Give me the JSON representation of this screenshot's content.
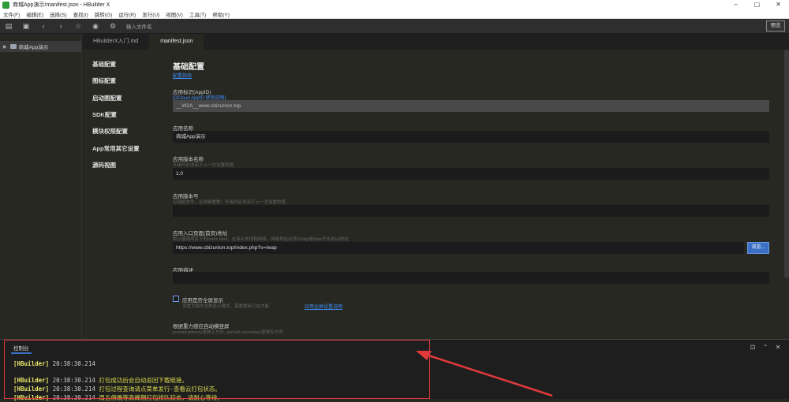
{
  "window": {
    "title": "商城App演示/manifest.json - HBuilder X",
    "controls": [
      "–",
      "▢",
      "✕"
    ]
  },
  "menubar": [
    "文件(F)",
    "编辑(E)",
    "选择(S)",
    "查找(I)",
    "跳转(G)",
    "运行(R)",
    "发行(U)",
    "视图(V)",
    "工具(T)",
    "帮助(Y)"
  ],
  "toolbar": {
    "search_placeholder": "输入文件名",
    "preview_label": "预览"
  },
  "sidebar": {
    "project": "商城App演示"
  },
  "tabs": [
    {
      "label": "HBuilderX入门.md"
    },
    {
      "label": "manifest.json"
    }
  ],
  "confnav": [
    "基础配置",
    "图标配置",
    "启动图配置",
    "SDK配置",
    "模块权限配置",
    "App常用其它设置",
    "源码视图"
  ],
  "main": {
    "heading": "基础配置",
    "heading_link": "配置指南",
    "appid_label": "应用标识(AppID)",
    "appid_link": "[DCloud AppID 使用说明]",
    "appid_value": "__W2A__www.cbizunion.top",
    "name_label": "应用名称",
    "name_value": "商城App演示",
    "version_label": "应用版本名称",
    "version_hint": "升级时必须高于上一次设置的值",
    "version_value": "1.0",
    "code_label": "应用版本号",
    "code_hint": "应用版本号，必须是整数；升级时必须高于上一次设置的值",
    "code_value": "",
    "entry_label": "应用入口页面(首页)地址",
    "entry_hint": "默认使用项目下的index.html，支持从本地和网络，网络地址必须以http或https开头的url地址",
    "entry_value": "https://www.cbizunion.top/index.php?s=/wap",
    "browse_label": "浏览...",
    "desc_label": "应用描述",
    "desc_value": "",
    "fullscreen_label": "应用是否全屏显示",
    "fullscreen_hint": "设置页面的全屏显示模式，需要重新打包才能",
    "fullscreen_link": "应用全屏设置说明",
    "orientation_label": "根据重力感应自动横竖屏",
    "orientation_hint": "portrait-primary竖屏正方向, portrait-secondary竖屏反方向"
  },
  "console": {
    "tab": "控制台",
    "lines": [
      {
        "tag": "[HBuilder]",
        "time": "20:38:30.214",
        "msg": ""
      },
      {
        "tag": "",
        "time": "",
        "msg": ""
      },
      {
        "tag": "[HBuilder]",
        "time": "20:38:30.214",
        "msg": "打包成功后会自动返回下载链接。"
      },
      {
        "tag": "[HBuilder]",
        "time": "20:38:30.214",
        "msg": "打包过程查询请点菜单发行-查看云打包状态。"
      },
      {
        "tag": "[HBuilder]",
        "time": "20:38:30.214",
        "msg": "周五傍晚等高峰期打包排队较长，请耐心等待。"
      }
    ]
  },
  "colors": {
    "accent": "#3f8ef7",
    "annotation": "#e0393b",
    "log": "#d9d94f"
  }
}
